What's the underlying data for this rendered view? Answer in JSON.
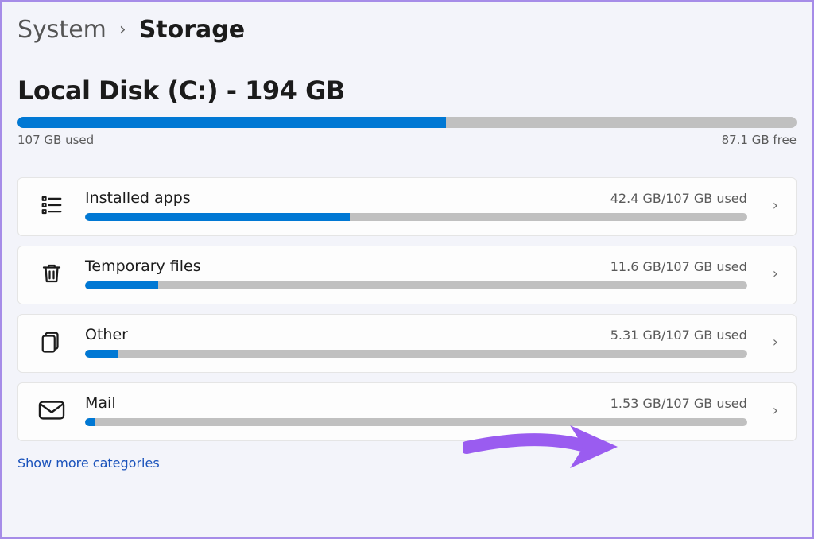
{
  "breadcrumb": {
    "parent": "System",
    "current": "Storage"
  },
  "disk": {
    "title": "Local Disk (C:) - 194 GB",
    "used_label": "107 GB used",
    "free_label": "87.1 GB free",
    "fill_percent": 55
  },
  "categories": [
    {
      "icon": "apps",
      "name": "Installed apps",
      "usage": "42.4 GB/107 GB used",
      "fill_percent": 40
    },
    {
      "icon": "trash",
      "name": "Temporary files",
      "usage": "11.6 GB/107 GB used",
      "fill_percent": 11
    },
    {
      "icon": "other",
      "name": "Other",
      "usage": "5.31 GB/107 GB used",
      "fill_percent": 5
    },
    {
      "icon": "mail",
      "name": "Mail",
      "usage": "1.53 GB/107 GB used",
      "fill_percent": 1.5
    }
  ],
  "show_more": "Show more categories",
  "annotation": {
    "arrow_color": "#9a5cf0"
  }
}
